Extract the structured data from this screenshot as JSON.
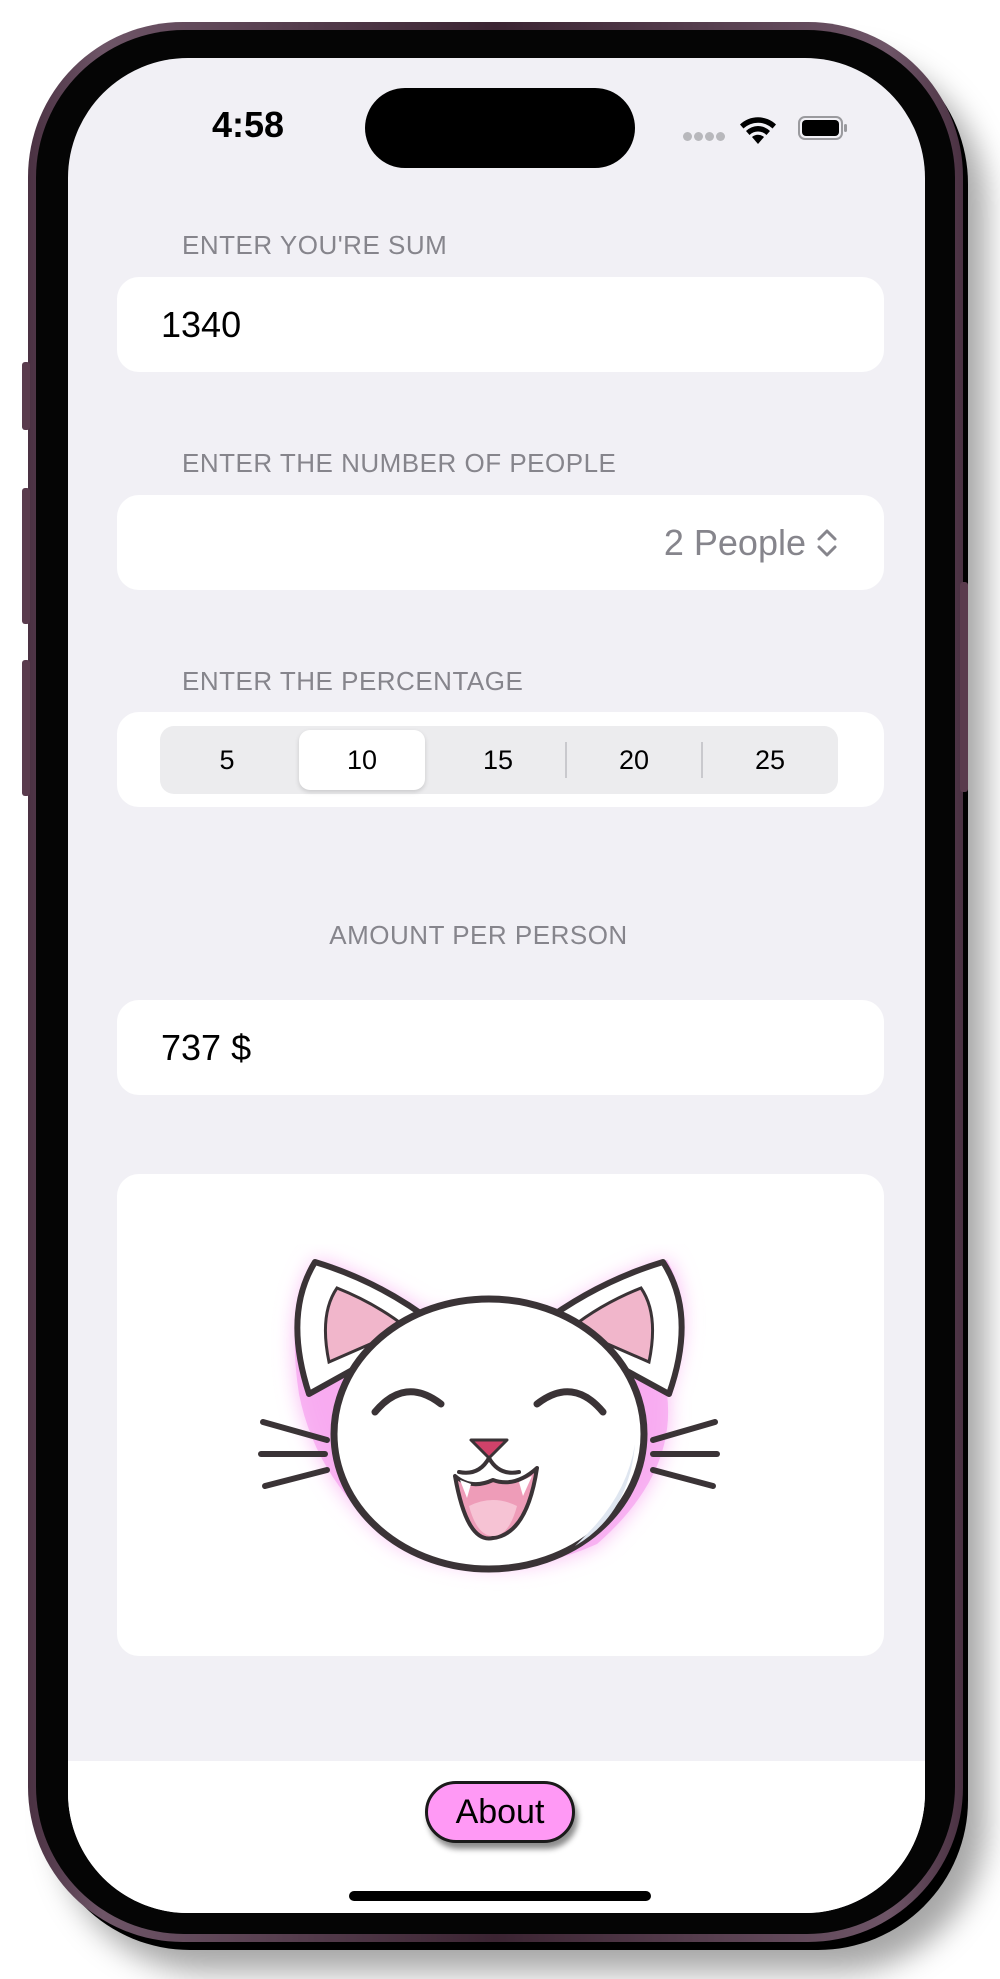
{
  "status_bar": {
    "time": "4:58",
    "icons": [
      "cellular-dots-icon",
      "wifi-icon",
      "battery-icon"
    ]
  },
  "sum_section": {
    "label": "ENTER YOU'RE SUM",
    "value": "1340"
  },
  "people_section": {
    "label": "ENTER THE NUMBER OF PEOPLE",
    "selected": "2 People",
    "icon": "chevron-up-down-icon"
  },
  "percentage_section": {
    "label": "ENTER THE PERCENTAGE",
    "options": [
      "5",
      "10",
      "15",
      "20",
      "25"
    ],
    "selected": "10"
  },
  "result_section": {
    "label": "AMOUNT PER PERSON",
    "value": "737 $"
  },
  "illustration": {
    "icon": "happy-cat-face-icon"
  },
  "bottom_bar": {
    "about_label": "About"
  },
  "colors": {
    "background": "#f1f0f5",
    "card": "#ffffff",
    "label_gray": "#86858c",
    "about_button": "#ff99f5",
    "cat_glow": "#f7a8f0"
  }
}
